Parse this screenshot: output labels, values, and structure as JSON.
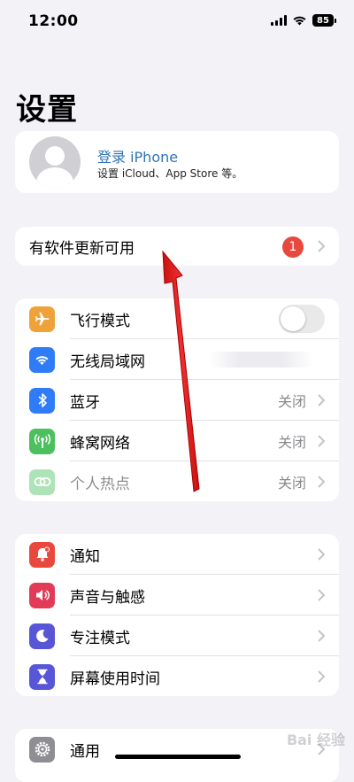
{
  "status_bar": {
    "time": "12:00",
    "battery": "85"
  },
  "page_title": "设置",
  "profile": {
    "title": "登录 iPhone",
    "subtitle": "设置 iCloud、App Store 等。"
  },
  "update": {
    "label": "有软件更新可用",
    "badge": "1"
  },
  "network_group": [
    {
      "name": "airplane",
      "label": "飞行模式",
      "icon": "airplane-icon",
      "color": "#f0a23a",
      "toggle": false
    },
    {
      "name": "wifi",
      "label": "无线局域网",
      "icon": "wifi-icon",
      "color": "#2f7cf6"
    },
    {
      "name": "bluetooth",
      "label": "蓝牙",
      "icon": "bluetooth-icon",
      "color": "#2f7cf6",
      "value": "关闭"
    },
    {
      "name": "cellular",
      "label": "蜂窝网络",
      "icon": "antenna-icon",
      "color": "#4cc05f",
      "value": "关闭"
    },
    {
      "name": "hotspot",
      "label": "个人热点",
      "icon": "hotspot-icon",
      "color": "#4cc05f",
      "value": "关闭",
      "disabled": true
    }
  ],
  "notifications_group": [
    {
      "name": "notifications",
      "label": "通知",
      "icon": "bell-icon",
      "color": "#e8483d"
    },
    {
      "name": "sounds",
      "label": "声音与触感",
      "icon": "speaker-icon",
      "color": "#e23b57"
    },
    {
      "name": "focus",
      "label": "专注模式",
      "icon": "moon-icon",
      "color": "#5856d6"
    },
    {
      "name": "screen-time",
      "label": "屏幕使用时间",
      "icon": "hourglass-icon",
      "color": "#5856d6"
    }
  ],
  "general_group": [
    {
      "name": "general",
      "label": "通用",
      "icon": "gear-icon",
      "color": "#8e8e93"
    }
  ],
  "watermark": "Bai 经验"
}
